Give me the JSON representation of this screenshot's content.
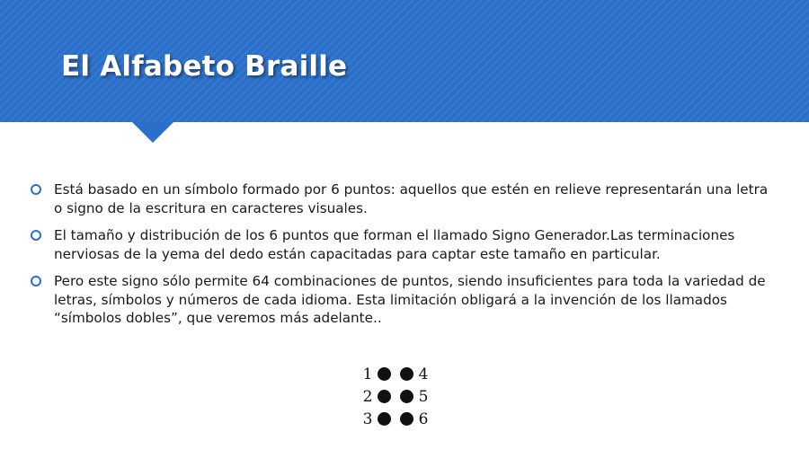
{
  "slide": {
    "title": "El Alfabeto Braille",
    "accent_color": "#2a6fc9"
  },
  "bullets": [
    "Está basado en un símbolo formado por 6 puntos: aquellos que estén en relieve representarán una letra o signo de la escritura en caracteres visuales.",
    "El tamaño y distribución de los 6 puntos que forman el llamado Signo Generador.Las terminaciones nerviosas de la yema del dedo están capacitadas para captar este tamaño en particular.",
    "Pero este signo sólo permite 64 combinaciones de puntos, siendo insuficientes para toda la variedad de letras, símbolos y números de cada idioma. Esta limitación obligará a la invención de los llamados “símbolos dobles”, que veremos más adelante.."
  ],
  "braille_cell": {
    "rows": [
      {
        "left": "1",
        "right": "4"
      },
      {
        "left": "2",
        "right": "5"
      },
      {
        "left": "3",
        "right": "6"
      }
    ]
  }
}
